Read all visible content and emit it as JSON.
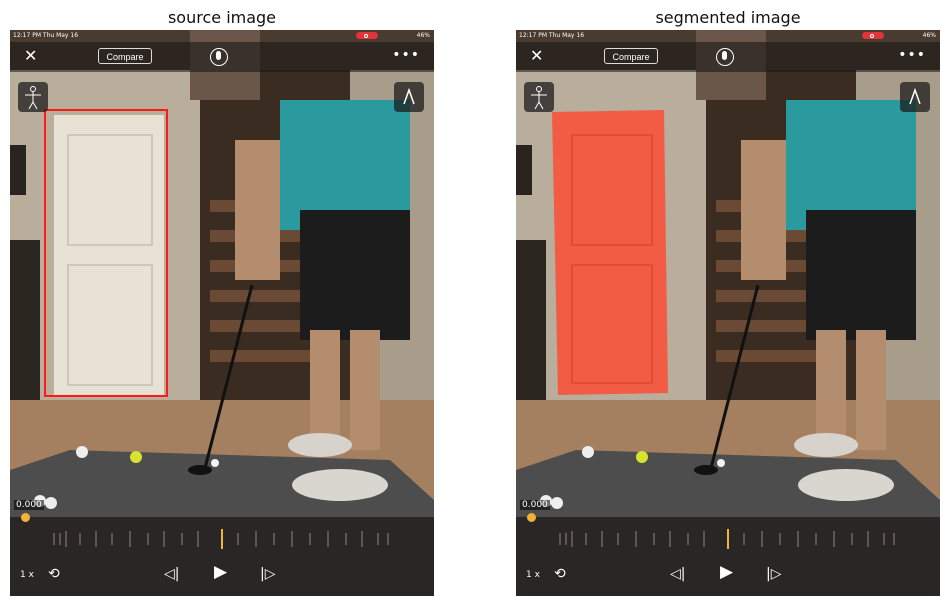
{
  "panels": [
    {
      "title": "source image"
    },
    {
      "title": "segmented image"
    }
  ],
  "app": {
    "status_time": "12:17 PM  Thu May 16",
    "status_right": "46%",
    "compare_label": "Compare",
    "timecode": "0.000",
    "speed_label": "1 x",
    "icons": [
      "close-icon",
      "microphone-icon",
      "more-icon",
      "skeleton-icon",
      "pen-tool-icon",
      "loop-icon",
      "step-back-icon",
      "play-icon",
      "step-forward-icon"
    ]
  },
  "colors": {
    "bounding_box": "#ff1a1a",
    "segmentation_mask": "#f25c45",
    "scrubber": "#f1b13a"
  }
}
